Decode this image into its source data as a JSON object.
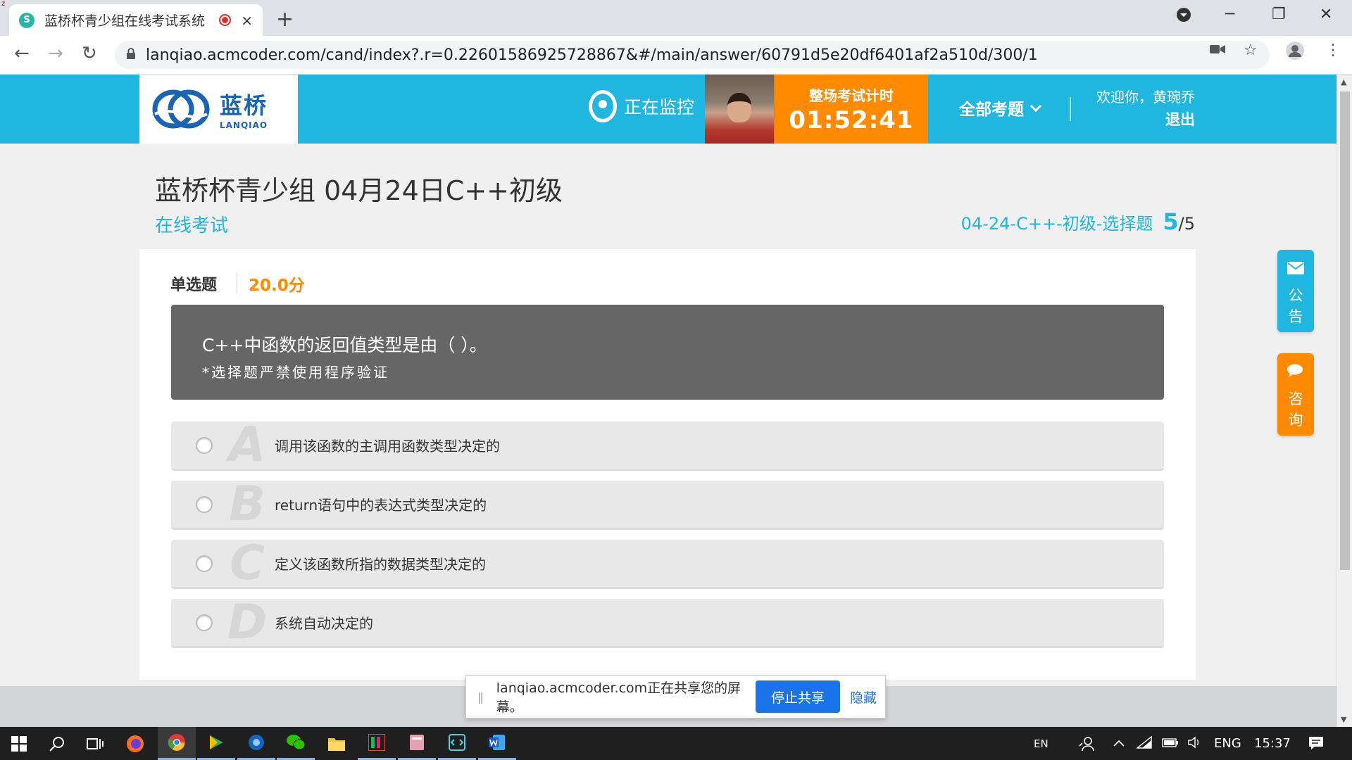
{
  "browser": {
    "tab_title": "蓝桥杯青少组在线考试系统",
    "tab_close": "×",
    "new_tab": "+",
    "url": "lanqiao.acmcoder.com/cand/index?.r=0.22601586925728867&#/main/answer/60791d5e20df6401af2a510d/300/1",
    "nav": {
      "back": "←",
      "forward": "→",
      "reload": "↻"
    },
    "window_controls": {
      "minimize": "─",
      "maximize": "❐",
      "close": "✕"
    }
  },
  "header": {
    "logo_cn": "蓝桥",
    "logo_en": "LANQIAO",
    "monitor_label": "正在监控",
    "timer_label": "整场考试计时",
    "timer_value": "01:52:41",
    "all_questions": "全部考题",
    "welcome": "欢迎你，黄琬乔",
    "logout": "退出"
  },
  "exam": {
    "title": "蓝桥杯青少组 04月24日C++初级",
    "subtitle": "在线考试",
    "section": "04-24-C++-初级-选择题",
    "current": "5",
    "total": "/5"
  },
  "question": {
    "type": "单选题",
    "score": "20.0分",
    "stem": "C++中函数的返回值类型是由（ ）。",
    "note": "*选择题严禁使用程序验证",
    "options": [
      {
        "letter": "A",
        "text": "调用该函数的主调用函数类型决定的"
      },
      {
        "letter": "B",
        "text": "return语句中的表达式类型决定的"
      },
      {
        "letter": "C",
        "text": "定义该函数所指的数据类型决定的"
      },
      {
        "letter": "D",
        "text": "系统自动决定的"
      }
    ]
  },
  "floats": {
    "notice": [
      "公",
      "告"
    ],
    "consult": [
      "咨",
      "询"
    ]
  },
  "share_bar": {
    "grip": "||",
    "text": "lanqiao.acmcoder.com正在共享您的屏幕。",
    "stop": "停止共享",
    "hide": "隐藏"
  },
  "taskbar": {
    "ime": "EN",
    "lang": "ENG",
    "time": "15:37"
  },
  "colors": {
    "header_bg": "#1fb6e0",
    "timer_bg": "#ff8a00",
    "stem_bg": "#666666",
    "float_blue": "#1fb6e0",
    "float_orange": "#ff8a00"
  }
}
